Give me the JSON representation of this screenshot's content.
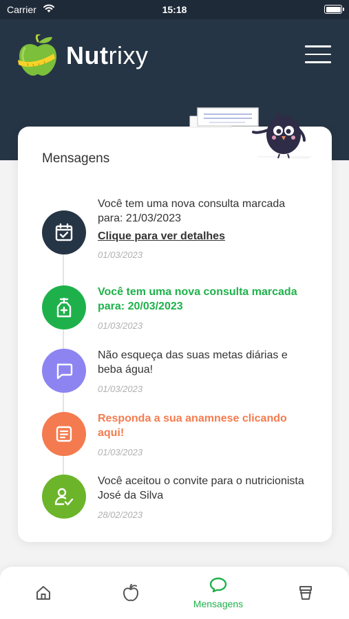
{
  "status_bar": {
    "carrier": "Carrier",
    "time": "15:18",
    "battery_level": 1.0
  },
  "header": {
    "logo_text_bold": "Nut",
    "logo_text_rest": "rixy"
  },
  "messages_card": {
    "title": "Mensagens",
    "items": [
      {
        "icon": "calendar-check-icon",
        "icon_color": "#263545",
        "text": "Você tem uma nova consulta marcada para: 21/03/2023",
        "link": "Clique para ver detalhes",
        "date": "01/03/2023",
        "text_color": "#333333",
        "bold": false
      },
      {
        "icon": "medicine-bottle-icon",
        "icon_color": "#1eb14b",
        "text": "Você tem uma nova consulta marcada para: 20/03/2023",
        "date": "01/03/2023",
        "text_color": "#1eb14b",
        "bold": true
      },
      {
        "icon": "chat-bubble-icon",
        "icon_color": "#8d84f2",
        "text": "Não esqueça das suas metas diárias e beba água!",
        "date": "01/03/2023",
        "text_color": "#333333",
        "bold": false
      },
      {
        "icon": "document-icon",
        "icon_color": "#f47b4f",
        "text": "Responda a sua anamnese clicando aqui!",
        "date": "01/03/2023",
        "text_color": "#f47b4f",
        "bold": true
      },
      {
        "icon": "user-check-icon",
        "icon_color": "#6cb52a",
        "text": "Você aceitou o convite para o nutricionista José da Silva",
        "date": "28/02/2023",
        "text_color": "#333333",
        "bold": false
      }
    ]
  },
  "bottom_nav": {
    "active_color": "#1eb14b",
    "items": [
      {
        "icon": "home-icon",
        "label": ""
      },
      {
        "icon": "apple-icon",
        "label": ""
      },
      {
        "icon": "chat-bubble-icon",
        "label": "Mensagens",
        "active": true
      },
      {
        "icon": "food-container-icon",
        "label": ""
      }
    ]
  }
}
